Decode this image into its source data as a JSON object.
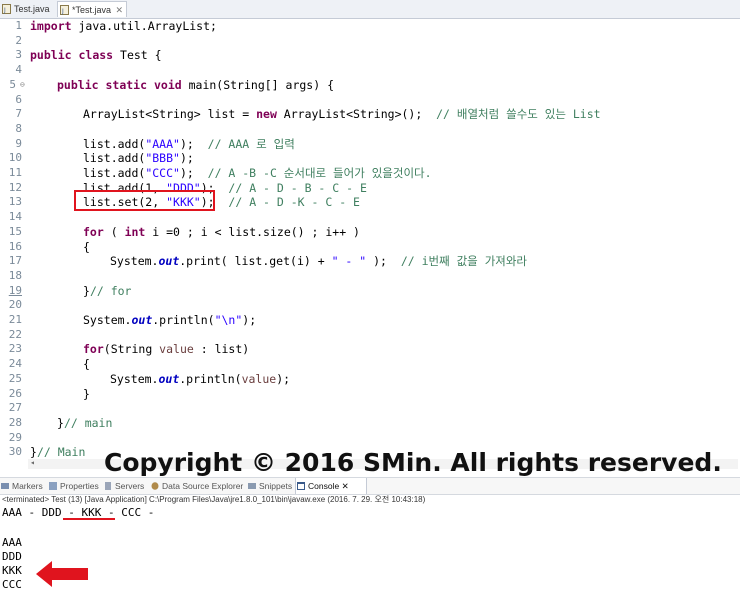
{
  "tabs": [
    {
      "label": "Test.java",
      "active": false
    },
    {
      "label": "*Test.java",
      "active": true,
      "close": "✕"
    }
  ],
  "editor": {
    "lines": [
      {
        "n": "1"
      },
      {
        "n": "2"
      },
      {
        "n": "3"
      },
      {
        "n": "4"
      },
      {
        "n": "5"
      },
      {
        "n": "6"
      },
      {
        "n": "7"
      },
      {
        "n": "8"
      },
      {
        "n": "9"
      },
      {
        "n": "10"
      },
      {
        "n": "11"
      },
      {
        "n": "12"
      },
      {
        "n": "13"
      },
      {
        "n": "14"
      },
      {
        "n": "15"
      },
      {
        "n": "16"
      },
      {
        "n": "17"
      },
      {
        "n": "18"
      },
      {
        "n": "19"
      },
      {
        "n": "20"
      },
      {
        "n": "21"
      },
      {
        "n": "22"
      },
      {
        "n": "23"
      },
      {
        "n": "24"
      },
      {
        "n": "25"
      },
      {
        "n": "26"
      },
      {
        "n": "27"
      },
      {
        "n": "28"
      },
      {
        "n": "29"
      },
      {
        "n": "30"
      }
    ],
    "code": {
      "l1_kw": "import",
      "l1_rest": " java.util.ArrayList;",
      "l3_kw1": "public",
      "l3_kw2": "class",
      "l3_rest": " Test {",
      "l5_kw1": "public",
      "l5_kw2": "static",
      "l5_kw3": "void",
      "l5_rest": " main(String[] args) {",
      "l7_a": "ArrayList<String> list = ",
      "l7_kw": "new",
      "l7_b": " ArrayList<String>();  ",
      "l7_cm": "// 배열처럼 쓸수도 있는 List",
      "l9_a": "list.add(",
      "l9_s": "\"AAA\"",
      "l9_b": ");  ",
      "l9_cm": "// AAA 로 입력",
      "l10_a": "list.add(",
      "l10_s": "\"BBB\"",
      "l10_b": ");",
      "l11_a": "list.add(",
      "l11_s": "\"CCC\"",
      "l11_b": ");  ",
      "l11_cm": "// A -B -C 순서대로 들어가 있을것이다.",
      "l12_a": "list.add(1, ",
      "l12_s": "\"DDD\"",
      "l12_b": ");  ",
      "l12_cm": "// A - D - B - C - E",
      "l13_a": "list.set(2, ",
      "l13_s": "\"KKK\"",
      "l13_b": ");  ",
      "l13_cm": "// A - D -K - C - E",
      "l15_kw1": "for",
      "l15_a": " ( ",
      "l15_kw2": "int",
      "l15_b": " i =0 ; i < list.size() ; i++ )",
      "l16": "{",
      "l17_a": "System.",
      "l17_f": "out",
      "l17_b": ".print( list.get(i) + ",
      "l17_s": "\" - \"",
      "l17_c": " );  ",
      "l17_cm": "// i번째 값을 가져와라",
      "l19_a": "}",
      "l19_cm": "// for",
      "l21_a": "System.",
      "l21_f": "out",
      "l21_b": ".println(",
      "l21_s": "\"\\n\"",
      "l21_c": ");",
      "l23_kw": "for",
      "l23_a": "(String ",
      "l23_v": "value",
      "l23_b": " : list)",
      "l24": "{",
      "l25_a": "System.",
      "l25_f": "out",
      "l25_b": ".println(",
      "l25_v": "value",
      "l25_c": ");",
      "l26": "}",
      "l28_a": "}",
      "l28_cm": "// main",
      "l30_a": "}",
      "l30_cm": "// Main"
    }
  },
  "watermark": "Copyright © 2016 SMin. All rights reserved.",
  "views": [
    {
      "label": "Markers",
      "active": false,
      "color": "#7a8fb0"
    },
    {
      "label": "Properties",
      "active": false,
      "color": "#8aa0c0"
    },
    {
      "label": "Servers",
      "active": false,
      "color": "#9aa5b8"
    },
    {
      "label": "Data Source Explorer",
      "active": false,
      "color": "#b08a4a"
    },
    {
      "label": "Snippets",
      "active": false,
      "color": "#8a9ab0"
    },
    {
      "label": "Console",
      "active": true,
      "color": "#3a5a8a",
      "close": "✕"
    }
  ],
  "console": {
    "header": "<terminated> Test (13) [Java Application] C:\\Program Files\\Java\\jre1.8.0_101\\bin\\javaw.exe (2016. 7. 29. 오전 10:43:18)",
    "output": [
      "AAA - DDD - KKK - CCC - ",
      "",
      "",
      "AAA",
      "DDD",
      "KKK",
      "CCC"
    ]
  },
  "colors": {
    "highlight": "#e0141e"
  }
}
